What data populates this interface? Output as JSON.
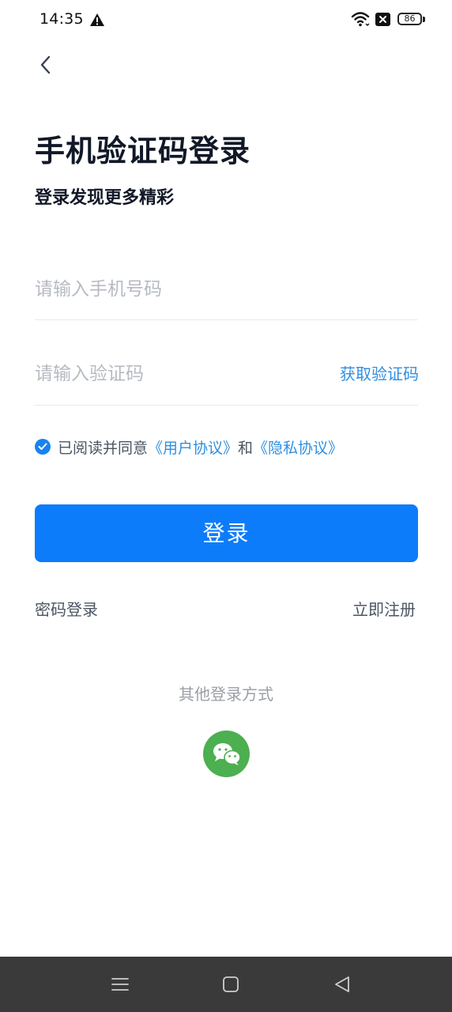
{
  "status_bar": {
    "time": "14:35",
    "battery": "86"
  },
  "header": {
    "back_icon": "chevron-left-icon",
    "title": "手机验证码登录",
    "subtitle": "登录发现更多精彩"
  },
  "form": {
    "phone_placeholder": "请输入手机号码",
    "code_placeholder": "请输入验证码",
    "get_code_label": "获取验证码"
  },
  "agreement": {
    "checked": true,
    "prefix": "已阅读并同意",
    "user_agreement": "《用户协议》",
    "conjunction": "和",
    "privacy_agreement": "《隐私协议》"
  },
  "actions": {
    "login_label": "登录",
    "password_login": "密码登录",
    "register": "立即注册"
  },
  "other_login": {
    "title": "其他登录方式",
    "wechat_icon": "wechat-icon"
  },
  "colors": {
    "primary": "#0d7cfa",
    "link": "#2f8fe0",
    "wechat": "#4caf50",
    "nav_bar": "#3a3a3a"
  }
}
